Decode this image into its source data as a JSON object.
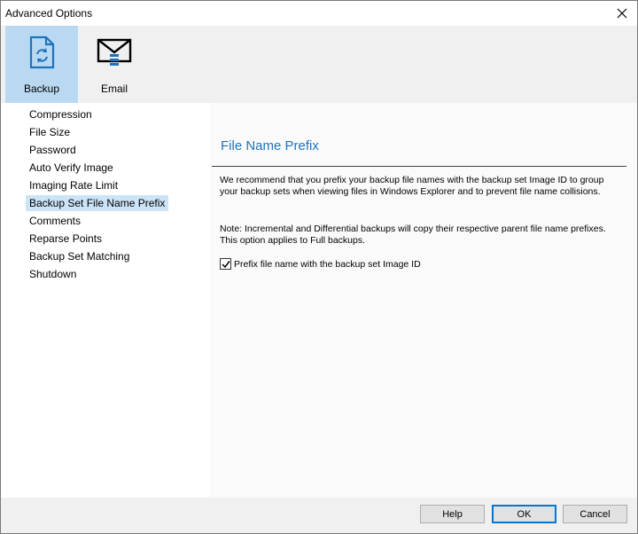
{
  "window": {
    "title": "Advanced Options"
  },
  "toolbar": {
    "items": [
      {
        "label": "Backup",
        "icon": "backup-document-icon",
        "active": true
      },
      {
        "label": "Email",
        "icon": "email-envelope-icon",
        "active": false
      }
    ]
  },
  "sidebar": {
    "items": [
      {
        "label": "Compression"
      },
      {
        "label": "File Size"
      },
      {
        "label": "Password"
      },
      {
        "label": "Auto Verify Image"
      },
      {
        "label": "Imaging Rate Limit"
      },
      {
        "label": "Backup Set File Name Prefix",
        "selected": true
      },
      {
        "label": "Comments"
      },
      {
        "label": "Reparse Points"
      },
      {
        "label": "Backup Set Matching"
      },
      {
        "label": "Shutdown"
      }
    ]
  },
  "content": {
    "heading": "File Name Prefix",
    "paragraph1": "We recommend that you prefix your backup file names with the backup set Image ID to group your backup sets when viewing files in Windows Explorer and to prevent file name collisions.",
    "paragraph2": "Note: Incremental and Differential backups will copy their respective parent file name prefixes. This option applies to Full backups.",
    "checkbox": {
      "label": "Prefix file name with the backup set Image ID",
      "checked": true
    }
  },
  "footer": {
    "help_label": "Help",
    "ok_label": "OK",
    "cancel_label": "Cancel"
  },
  "colors": {
    "accent": "#1e73be",
    "active_tab_bg": "#b9d9f3",
    "selected_item_bg": "#cce4f7",
    "default_button_border": "#0078d7"
  }
}
